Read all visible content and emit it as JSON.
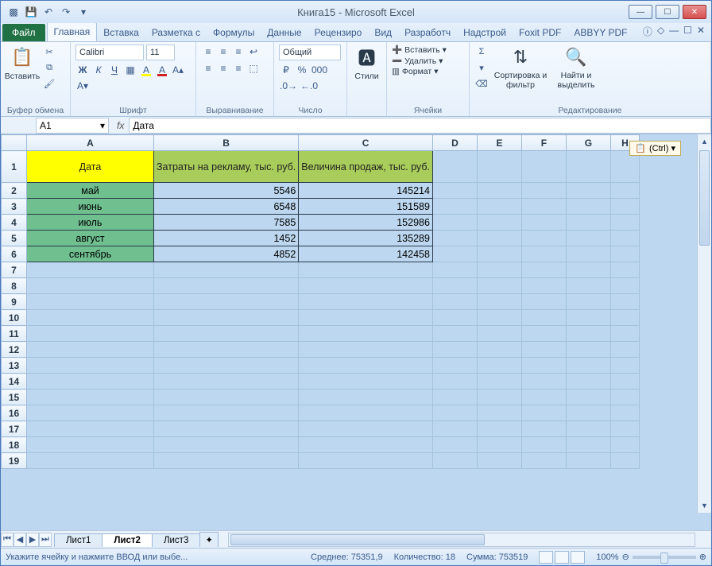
{
  "title": "Книга15 - Microsoft Excel",
  "tabs": {
    "file": "Файл",
    "list": [
      "Главная",
      "Вставка",
      "Разметка с",
      "Формулы",
      "Данные",
      "Рецензиро",
      "Вид",
      "Разработч",
      "Надстрой",
      "Foxit PDF",
      "ABBYY PDF"
    ],
    "active_index": 0
  },
  "ribbon": {
    "clipboard": {
      "paste": "Вставить",
      "label": "Буфер обмена"
    },
    "font": {
      "name": "Calibri",
      "size": "11",
      "bold": "Ж",
      "italic": "К",
      "underline": "Ч",
      "label": "Шрифт"
    },
    "align": {
      "label": "Выравнивание"
    },
    "number": {
      "format": "Общий",
      "label": "Число"
    },
    "styles": {
      "btn": "Стили",
      "label": ""
    },
    "cells": {
      "insert": "Вставить",
      "delete": "Удалить",
      "format": "Формат",
      "label": "Ячейки"
    },
    "editing": {
      "sort": "Сортировка и фильтр",
      "find": "Найти и выделить",
      "label": "Редактирование"
    }
  },
  "namebox": "A1",
  "fx_label": "fx",
  "formula": "Дата",
  "cols": [
    "A",
    "B",
    "C",
    "D",
    "E",
    "F",
    "G",
    "H"
  ],
  "rows_visible": 19,
  "chart_data": {
    "type": "table",
    "title": "",
    "headers": [
      "Дата",
      "Затраты на рекламу, тыс. руб.",
      "Величина продаж, тыс. руб."
    ],
    "rows": [
      [
        "май",
        5546,
        145214
      ],
      [
        "июнь",
        6548,
        151589
      ],
      [
        "июль",
        7585,
        152986
      ],
      [
        "август",
        1452,
        135289
      ],
      [
        "сентябрь",
        4852,
        142458
      ]
    ]
  },
  "smart_tag": "(Ctrl) ▾",
  "sheets": {
    "list": [
      "Лист1",
      "Лист2",
      "Лист3"
    ],
    "active_index": 1
  },
  "status": {
    "mode": "Укажите ячейку и нажмите ВВОД или выбе...",
    "avg_label": "Среднее:",
    "avg": "75351,9",
    "count_label": "Количество:",
    "count": "18",
    "sum_label": "Сумма:",
    "sum": "753519",
    "zoom": "100%"
  }
}
